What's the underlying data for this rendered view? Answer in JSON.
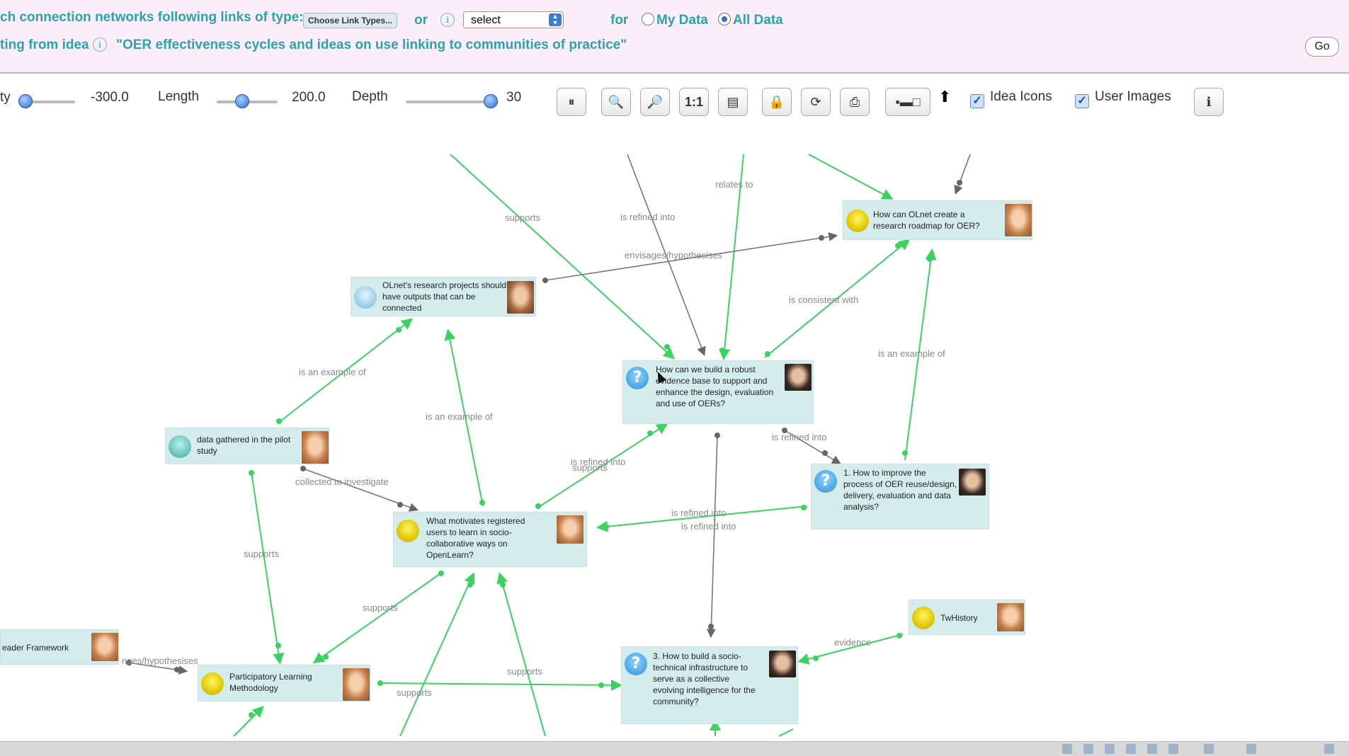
{
  "toolbar_top": {
    "row1_prefix": "ch connection networks following links of type:",
    "link_types_button": "Choose Link Types...",
    "or_label": "or",
    "select_value": "select",
    "for_label": "for",
    "radio_my_data": "My Data",
    "radio_all_data": "All Data",
    "row2_prefix": "ting from idea",
    "idea_title": "\"OER effectiveness cycles and ideas on use linking to communities of practice\"",
    "go_button": "Go"
  },
  "controls": {
    "repulsion_label": "ty",
    "repulsion_value": "-300.0",
    "length_label": "Length",
    "length_value": "200.0",
    "depth_label": "Depth",
    "depth_value": "30",
    "idea_icons_label": "Idea Icons",
    "user_images_label": "User Images",
    "buttons": [
      "pause-icon",
      "zoom-out-icon",
      "zoom-in-icon",
      "one-to-one-icon",
      "fit-page-icon",
      "lock-icon",
      "rotate-icon",
      "print-icon",
      "layout-icon",
      "arrow-up-icon",
      "info-icon"
    ]
  },
  "nodes": {
    "roadmap": "How can OLnet create a research roadmap for OER?",
    "research_projects": "OLnet's research projects should have outputs that can be connected",
    "evidence_base": "How can we build a robust evidence base to support and enhance the design, evaluation and use of OERs?",
    "pilot_data": "data gathered in the pilot study",
    "improve_process": "1. How to improve the process of OER reuse/design, delivery, evaluation and data analysis?",
    "motivates": "What motivates registered users to learn in socio-collaborative ways on OpenLearn?",
    "twhistory": "TwHistory",
    "leader_framework": "eader Framework",
    "participatory": "Participatory Learning Methodology",
    "socio_technical": "3. How to build a socio-technical infrastructure to serve as a collective evolving intelligence for the community?"
  },
  "edge_labels": {
    "relates_to": "relates to",
    "supports_1": "supports",
    "is_refined_into_1": "is refined into",
    "envisages": "envisages/hypothesises",
    "is_consistent_with": "is consistent with",
    "is_an_example_of_1": "is an example of",
    "is_an_example_of_2": "is an example of",
    "is_an_example_of_3": "is an example of",
    "is_refined_into_2": "is refined into",
    "is_refined_into_3": "is refined into",
    "supports_2": "supports",
    "collected_to": "collected to investigate",
    "is_refined_into_4": "is refined into",
    "is_refined_into_5": "is refined into",
    "supports_3": "supports",
    "supports_4": "supports",
    "evidence": "evidence",
    "envisages_2": "nges/hypothesises",
    "supports_5": "supports",
    "supports_6": "supports"
  },
  "colors": {
    "accent_teal": "#2aa3ae",
    "edge_green": "#39d35f",
    "edge_gray": "#777777",
    "node_bg": "#d5ecec",
    "topbar_bg": "#fbeef8"
  }
}
